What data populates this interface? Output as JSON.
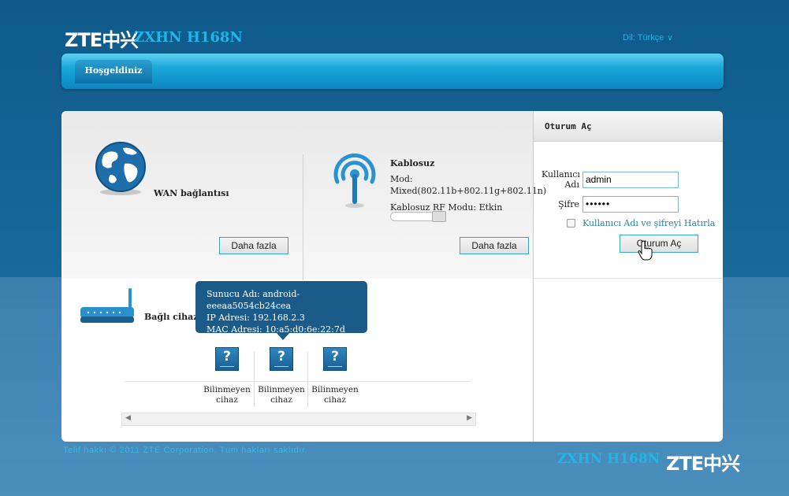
{
  "header": {
    "logo": "ZTE中兴",
    "model": "ZXHN H168N",
    "language": "Dil: Türkçe",
    "language_chevron": "∨"
  },
  "nav": {
    "tabs": [
      {
        "label": "Hoşgeldiniz"
      }
    ]
  },
  "wan": {
    "label": "WAN bağlantısı",
    "more_button": "Daha fazla"
  },
  "wireless": {
    "title": "Kablosuz",
    "mode_label": "Mod:",
    "mode_value": "Mixed(802.11b+802.11g+802.11n)",
    "rf_mode": "Kablosuz RF Modu: Etkin",
    "more_button": "Daha fazla"
  },
  "devices": {
    "label": "Bağlı cihazla",
    "tooltip": {
      "host": "Sunucu Adı: android-eeeaa5054cb24cea",
      "ip": "IP Adresi: 192.168.2.3",
      "mac": "MAC Adresi: 10:a5:d0:6e:22:7d"
    },
    "items": [
      {
        "icon": "?",
        "line1": "Bilinmeyen",
        "line2": "cihaz"
      },
      {
        "icon": "?",
        "line1": "Bilinmeyen",
        "line2": "cihaz"
      },
      {
        "icon": "?",
        "line1": "Bilinmeyen",
        "line2": "cihaz"
      }
    ]
  },
  "login": {
    "title": "Oturum Aç",
    "username_label_1": "Kullanıcı",
    "username_label_2": "Adı",
    "username_value": "admin",
    "password_label": "Şifre",
    "password_value": "••••••",
    "remember_label": "Kullanıcı Adı ve şifreyi Hatırla",
    "submit_button": "Oturum Aç"
  },
  "footer": {
    "copyright": "Telif hakkı © 2011 ZTE Corporation. Tüm hakları saklıdır.",
    "model": "ZXHN H168N",
    "logo": "ZTE中兴"
  },
  "colors": {
    "accent": "#1fb6e8",
    "nav": "#19a7d8",
    "tooltip": "#1b5b8a"
  }
}
